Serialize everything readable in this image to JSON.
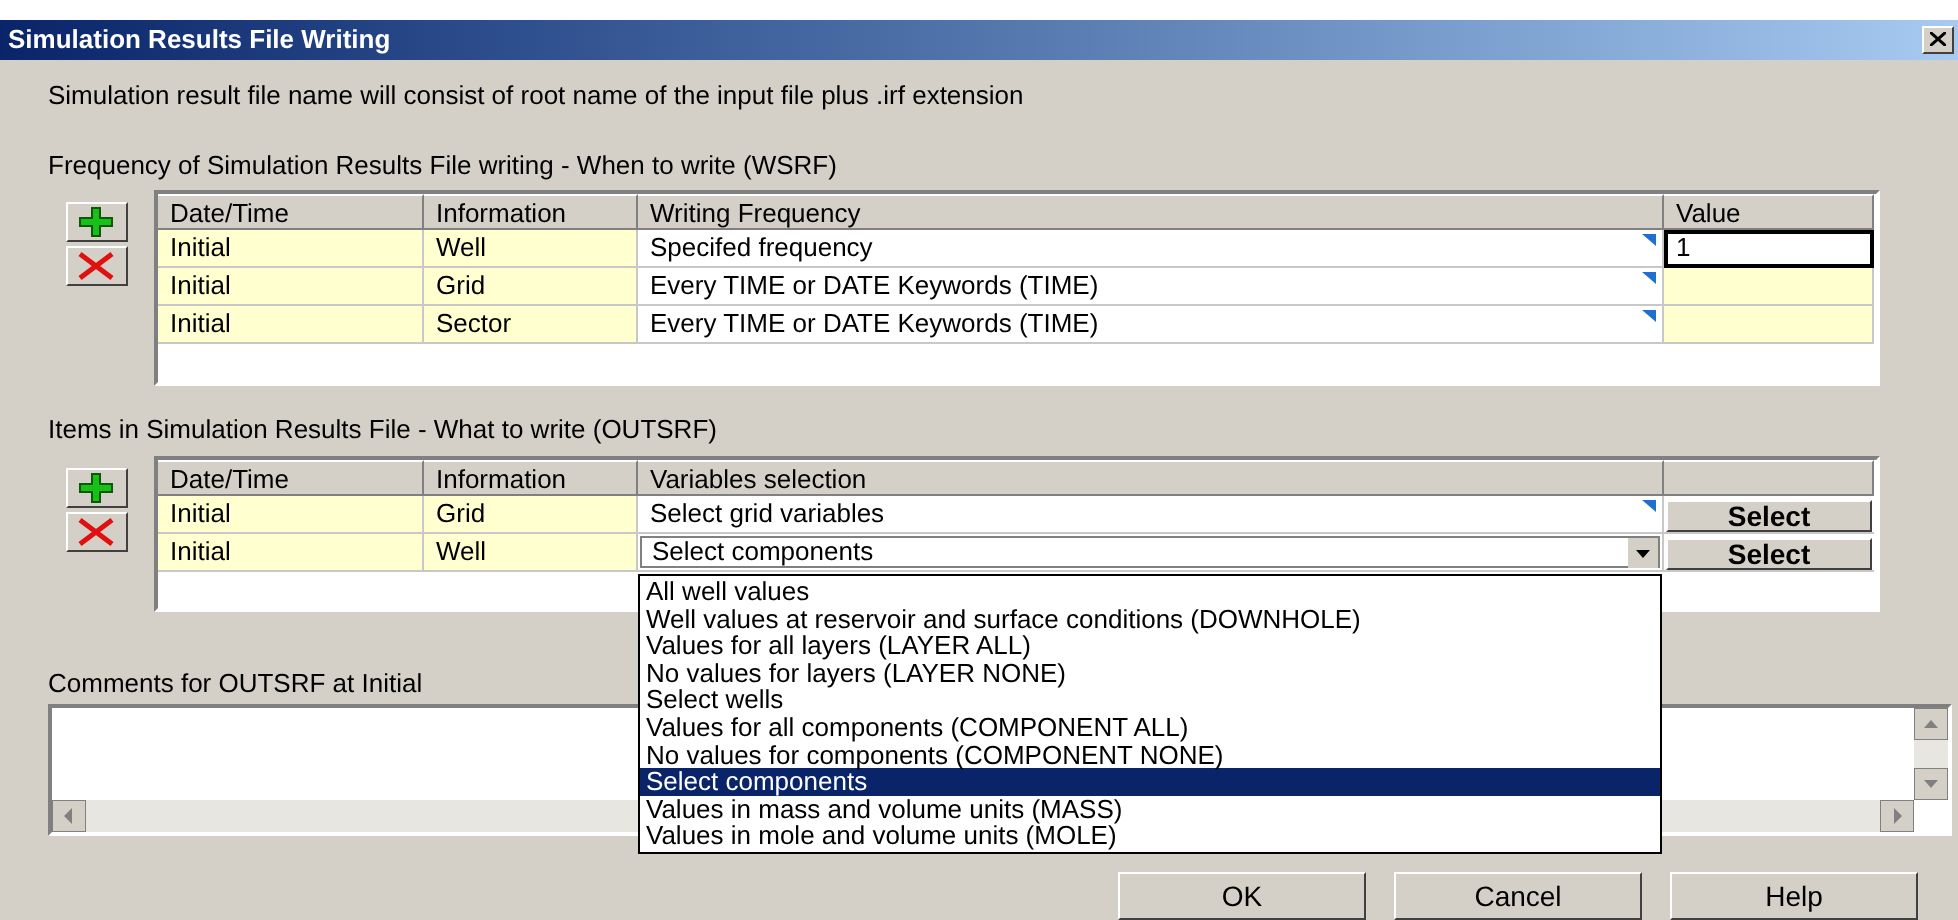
{
  "window": {
    "title": "Simulation Results File Writing"
  },
  "info": "Simulation result file name will consist of root name of the input file plus .irf extension",
  "frequency": {
    "label": "Frequency of Simulation Results File writing -  When to write (WSRF)",
    "columns": [
      "Date/Time",
      "Information",
      "Writing Frequency",
      "Value"
    ],
    "rows": [
      {
        "date_time": "Initial",
        "information": "Well",
        "writing_frequency": "Specifed frequency",
        "value": "1",
        "editing": true
      },
      {
        "date_time": "Initial",
        "information": "Grid",
        "writing_frequency": "Every TIME or DATE Keywords (TIME)",
        "editing": false
      },
      {
        "date_time": "Initial",
        "information": "Sector",
        "writing_frequency": "Every TIME or DATE Keywords (TIME)",
        "editing": false
      }
    ]
  },
  "items": {
    "label": "Items in Simulation Results File - What to write (OUTSRF)",
    "columns": [
      "Date/Time",
      "Information",
      "Variables selection"
    ],
    "rows": [
      {
        "date_time": "Initial",
        "information": "Grid",
        "variables_selection": "Select grid variables",
        "kind": "text",
        "button": "Select"
      },
      {
        "date_time": "Initial",
        "information": "Well",
        "variables_selection": "Select components",
        "kind": "dropdown",
        "button": "Select"
      }
    ],
    "dropdown_options": [
      {
        "label": "All well values",
        "selected": false
      },
      {
        "label": "Well values at reservoir and surface conditions (DOWNHOLE)",
        "selected": false
      },
      {
        "label": "Values for all layers (LAYER ALL)",
        "selected": false
      },
      {
        "label": "No values for layers (LAYER NONE)",
        "selected": false
      },
      {
        "label": "Select wells",
        "selected": false
      },
      {
        "label": "Values for all components (COMPONENT ALL)",
        "selected": false
      },
      {
        "label": "No values for components (COMPONENT NONE)",
        "selected": false
      },
      {
        "label": "Select components",
        "selected": true
      },
      {
        "label": "Values in mass and volume units (MASS)",
        "selected": false
      },
      {
        "label": "Values in mole and volume units (MOLE)",
        "selected": false
      }
    ]
  },
  "comments": {
    "label": "Comments for OUTSRF at Initial"
  },
  "buttons": [
    "OK",
    "Cancel",
    "Help"
  ]
}
